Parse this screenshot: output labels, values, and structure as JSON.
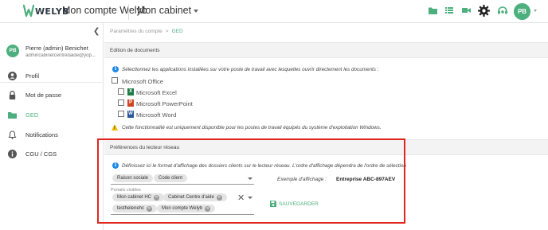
{
  "topbar": {
    "brand": "WELYB",
    "account_title": "Mon compte Welyb",
    "cabinet": "Mon cabinet",
    "avatar_initials": "PB",
    "icons": [
      "folder-icon",
      "list-icon",
      "video-icon",
      "gear-icon",
      "support-icon"
    ]
  },
  "sidebar": {
    "collapse_icon": "chevron-left-icon",
    "user": {
      "initials": "PB",
      "name": "Pierre (admin) Benichet",
      "email": "admincabinetcentredaide@yop..."
    },
    "items": [
      {
        "label": "Profil",
        "icon": "person-icon",
        "active": false
      },
      {
        "label": "Mot de passe",
        "icon": "lock-icon",
        "active": false
      },
      {
        "label": "GED",
        "icon": "folder-icon",
        "active": true
      },
      {
        "label": "Notifications",
        "icon": "bell-icon",
        "active": false
      },
      {
        "label": "CGU / CGS",
        "icon": "info-icon",
        "active": false
      }
    ]
  },
  "breadcrumb": {
    "parent": "Paramètres du compte",
    "separator": ">",
    "current": "GED"
  },
  "documents_section": {
    "title": "Edition de documents",
    "info": "Sélectionnez les applications installées sur votre poste de travail avec lesquelles ouvrir directement les documents :",
    "office": {
      "label": "Microsoft Office",
      "checked": false
    },
    "apps": [
      {
        "label": "Microsoft Excel",
        "letter": "X",
        "color": "#1f7a44",
        "checked": false
      },
      {
        "label": "Microsoft PowerPoint",
        "letter": "P",
        "color": "#d04423",
        "checked": false
      },
      {
        "label": "Microsoft Word",
        "letter": "W",
        "color": "#2b579a",
        "checked": false
      }
    ],
    "warning": "Cette fonctionnalité est uniquement disponible pour les postes de travail équipés du système d'exploitation Windows."
  },
  "network_section": {
    "title": "Préférences du lecteur réseau",
    "info": "Définissez ici le format d'affichage des dossiers clients sur le lecteur réseau. L'ordre d'affichage dépendra de l'ordre de sélection",
    "format_chips": [
      "Raison sociale",
      "Code client"
    ],
    "portals_label": "Portails visibles",
    "portal_chips": [
      "Mon cabinet HC",
      "Cabinet Centre d'aide",
      "testhelenehc",
      "Mon compte Welyb"
    ],
    "example_label": "Exemple d'affichage :",
    "example_value": "Entreprise ABC-897AEV",
    "save_label": "SAUVEGARDER"
  },
  "colors": {
    "accent": "#4caf7d",
    "highlight": "#e0261f",
    "info": "#1e88e5",
    "warning": "#f5b800"
  }
}
